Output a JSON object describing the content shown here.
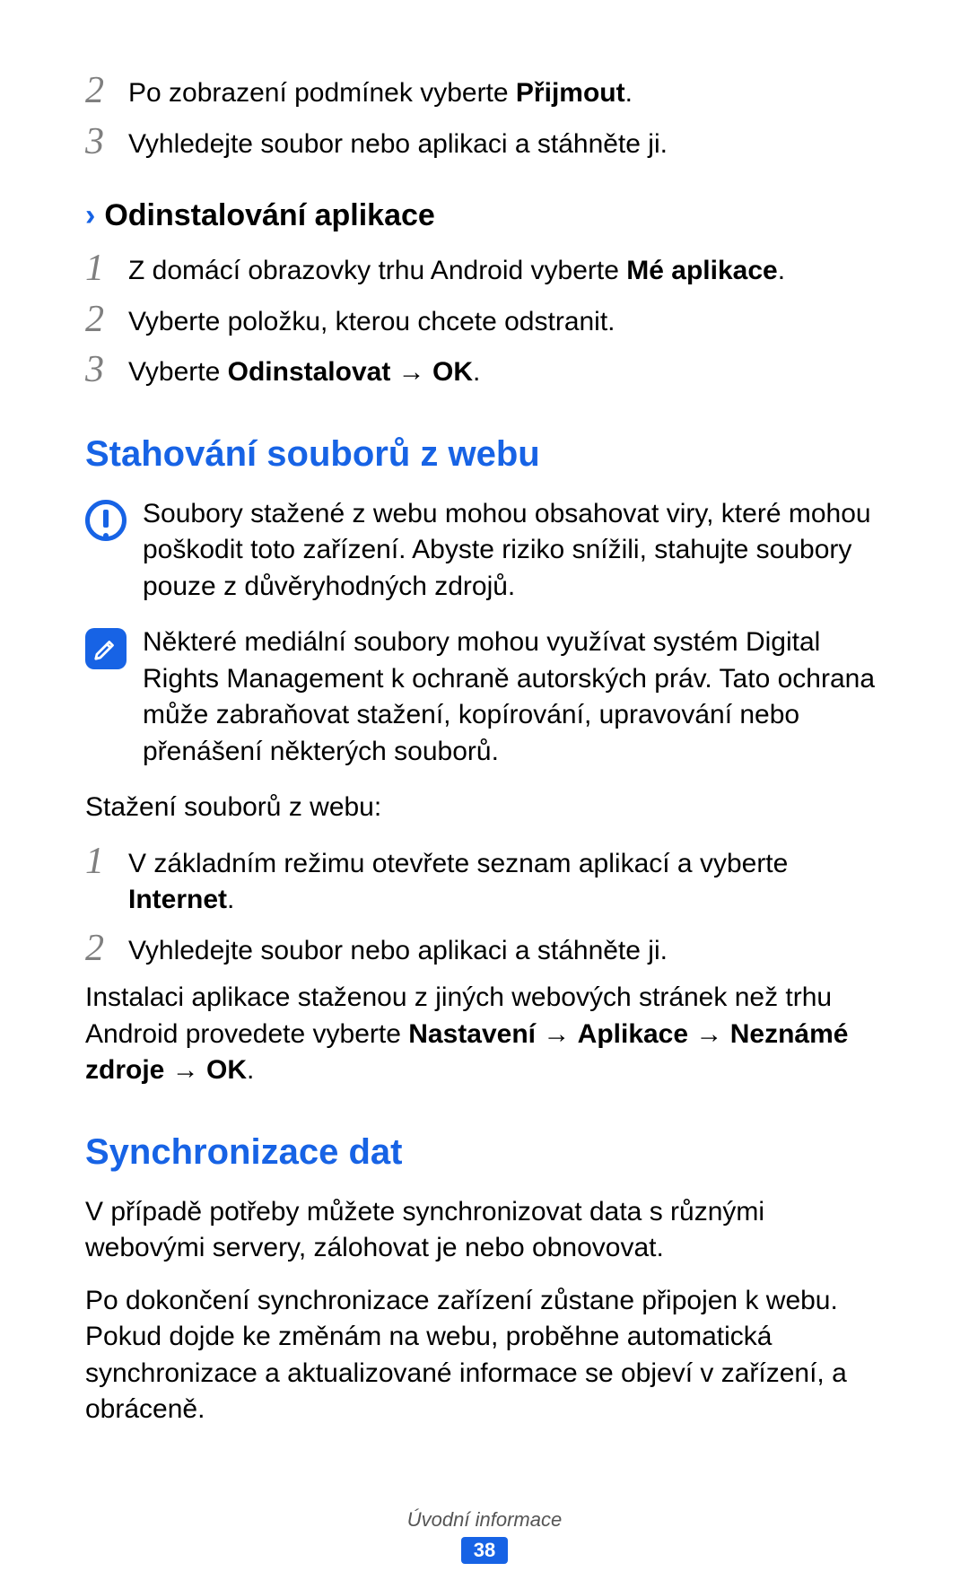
{
  "top_steps": [
    {
      "num": "2",
      "parts": [
        {
          "t": "Po zobrazení podmínek vyberte "
        },
        {
          "t": "Přijmout",
          "b": true
        },
        {
          "t": "."
        }
      ]
    },
    {
      "num": "3",
      "parts": [
        {
          "t": "Vyhledejte soubor nebo aplikaci a stáhněte ji."
        }
      ]
    }
  ],
  "sub1": {
    "chevron": "›",
    "title": "Odinstalování aplikace",
    "steps": [
      {
        "num": "1",
        "parts": [
          {
            "t": "Z domácí obrazovky trhu Android vyberte "
          },
          {
            "t": "Mé aplikace",
            "b": true
          },
          {
            "t": "."
          }
        ]
      },
      {
        "num": "2",
        "parts": [
          {
            "t": "Vyberte položku, kterou chcete odstranit."
          }
        ]
      },
      {
        "num": "3",
        "parts": [
          {
            "t": "Vyberte "
          },
          {
            "t": "Odinstalovat",
            "b": true
          },
          {
            "t": " → "
          },
          {
            "t": "OK",
            "b": true
          },
          {
            "t": "."
          }
        ]
      }
    ]
  },
  "h1": "Stahování souborů z webu",
  "warn": "Soubory stažené z webu mohou obsahovat viry, které mohou poškodit toto zařízení. Abyste riziko snížili, stahujte soubory pouze z důvěryhodných zdrojů.",
  "note": "Některé mediální soubory mohou využívat systém Digital Rights Management k ochraně autorských práv. Tato ochrana může zabraňovat stažení, kopírování, upravování nebo přenášení některých souborů.",
  "intro": "Stažení souborů z webu:",
  "dl_steps": [
    {
      "num": "1",
      "parts": [
        {
          "t": "V základním režimu otevřete seznam aplikací a vyberte "
        },
        {
          "t": "Internet",
          "b": true
        },
        {
          "t": "."
        }
      ]
    },
    {
      "num": "2",
      "parts": [
        {
          "t": "Vyhledejte soubor nebo aplikaci a stáhněte ji."
        }
      ]
    }
  ],
  "install_parts": [
    {
      "t": "Instalaci aplikace staženou z jiných webových stránek než trhu Android provedete vyberte "
    },
    {
      "t": "Nastavení",
      "b": true
    },
    {
      "t": " → "
    },
    {
      "t": "Aplikace",
      "b": true
    },
    {
      "t": " → "
    },
    {
      "t": "Neznámé zdroje",
      "b": true
    },
    {
      "t": " → "
    },
    {
      "t": "OK",
      "b": true
    },
    {
      "t": "."
    }
  ],
  "h2": "Synchronizace dat",
  "sync_p1": "V případě potřeby můžete synchronizovat data s různými webovými servery, zálohovat je nebo obnovovat.",
  "sync_p2": "Po dokončení synchronizace zařízení zůstane připojen k webu. Pokud dojde ke změnám na webu, proběhne automatická synchronizace a aktualizované informace se objeví v zařízení, a obráceně.",
  "footer_label": "Úvodní informace",
  "page_number": "38"
}
